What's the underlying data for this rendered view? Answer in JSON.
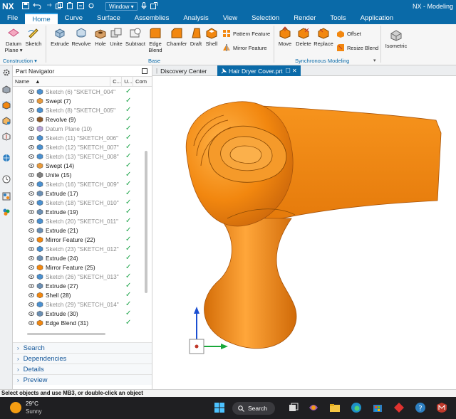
{
  "titlebar": {
    "logo": "NX",
    "window_menu": "Window ▾",
    "app_title": "NX - Modeling"
  },
  "menu_tabs": [
    "File",
    "Home",
    "Curve",
    "Surface",
    "Assemblies",
    "Analysis",
    "View",
    "Selection",
    "Render",
    "Tools",
    "Application"
  ],
  "active_tab": "Home",
  "ribbon": {
    "construction": {
      "label": "Construction ▾",
      "datum_plane": "Datum",
      "datum_plane2": "Plane ▾",
      "sketch": "Sketch"
    },
    "base": {
      "label": "Base",
      "extrude": "Extrude",
      "revolve": "Revolve",
      "hole": "Hole",
      "unite": "Unite",
      "subtract": "Subtract",
      "edge_blend": "Edge",
      "edge_blend2": "Blend",
      "chamfer": "Chamfer",
      "draft": "Draft",
      "shell": "Shell",
      "pattern_feature": "Pattern Feature",
      "mirror_feature": "Mirror Feature"
    },
    "sync": {
      "label": "Synchronous Modeling",
      "move": "Move",
      "delete": "Delete",
      "replace": "Replace",
      "offset": "Offset",
      "resize_blend": "Resize Blend"
    },
    "isometric": "Isometric"
  },
  "navigator": {
    "title": "Part Navigator",
    "columns": [
      "Name",
      "C...",
      "U...",
      "Com"
    ],
    "rows": [
      {
        "label": "Sketch (6) \"SKETCH_004\"",
        "dim": true,
        "type": "sketch"
      },
      {
        "label": "Swept (7)",
        "dim": false,
        "type": "swept"
      },
      {
        "label": "Sketch (8) \"SKETCH_005\"",
        "dim": true,
        "type": "sketch"
      },
      {
        "label": "Revolve (9)",
        "dim": false,
        "type": "revolve"
      },
      {
        "label": "Datum Plane (10)",
        "dim": true,
        "type": "datum"
      },
      {
        "label": "Sketch (11) \"SKETCH_006\"",
        "dim": true,
        "type": "sketch"
      },
      {
        "label": "Sketch (12) \"SKETCH_007\"",
        "dim": true,
        "type": "sketch"
      },
      {
        "label": "Sketch (13) \"SKETCH_008\"",
        "dim": true,
        "type": "sketch"
      },
      {
        "label": "Swept (14)",
        "dim": false,
        "type": "swept"
      },
      {
        "label": "Unite (15)",
        "dim": false,
        "type": "unite"
      },
      {
        "label": "Sketch (16) \"SKETCH_009\"",
        "dim": true,
        "type": "sketch"
      },
      {
        "label": "Extrude (17)",
        "dim": false,
        "type": "extrude"
      },
      {
        "label": "Sketch (18) \"SKETCH_010\"",
        "dim": true,
        "type": "sketch"
      },
      {
        "label": "Extrude (19)",
        "dim": false,
        "type": "extrude"
      },
      {
        "label": "Sketch (20) \"SKETCH_011\"",
        "dim": true,
        "type": "sketch"
      },
      {
        "label": "Extrude (21)",
        "dim": false,
        "type": "extrude"
      },
      {
        "label": "Mirror Feature (22)",
        "dim": false,
        "type": "mirror"
      },
      {
        "label": "Sketch (23) \"SKETCH_012\"",
        "dim": true,
        "type": "sketch"
      },
      {
        "label": "Extrude (24)",
        "dim": false,
        "type": "extrude"
      },
      {
        "label": "Mirror Feature (25)",
        "dim": false,
        "type": "mirror"
      },
      {
        "label": "Sketch (26) \"SKETCH_013\"",
        "dim": true,
        "type": "sketch"
      },
      {
        "label": "Extrude (27)",
        "dim": false,
        "type": "extrude"
      },
      {
        "label": "Shell (28)",
        "dim": false,
        "type": "shell"
      },
      {
        "label": "Sketch (29) \"SKETCH_014\"",
        "dim": true,
        "type": "sketch"
      },
      {
        "label": "Extrude (30)",
        "dim": false,
        "type": "extrude"
      },
      {
        "label": "Edge Blend (31)",
        "dim": false,
        "type": "blend"
      }
    ],
    "check": "✓",
    "sections": [
      "Search",
      "Dependencies",
      "Details",
      "Preview"
    ]
  },
  "doc_tabs": {
    "discovery": "Discovery Center",
    "active": "Hair Dryer Cover.prt",
    "active_marks": "☐ ✕"
  },
  "status_text": "Select objects and use MB3, or double-click an object",
  "taskbar": {
    "temp": "29°C",
    "condition": "Sunny",
    "search": "Search"
  },
  "colors": {
    "accent": "#0a6aa8",
    "model": "#f2870f",
    "check": "#1aa347"
  }
}
